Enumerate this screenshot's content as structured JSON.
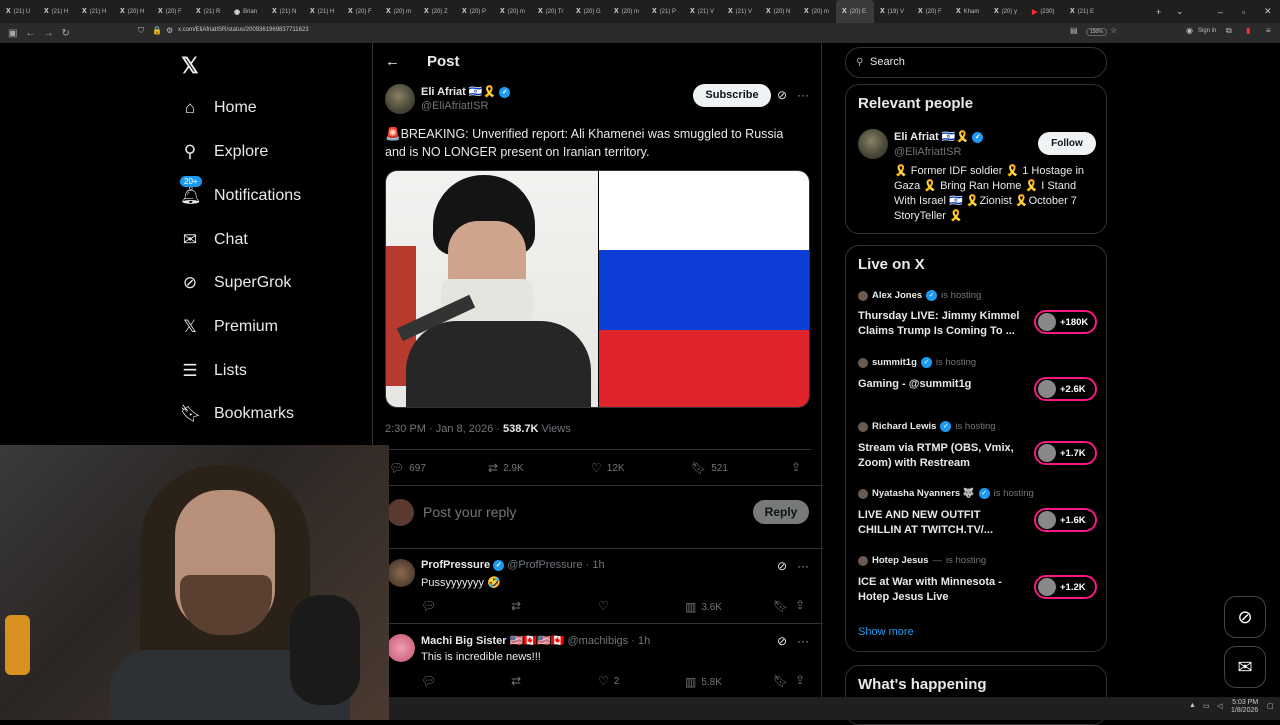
{
  "browser": {
    "tabs": [
      "(21) U",
      "(21) H",
      "(21) H",
      "(20) H",
      "(20) F",
      "(21) R",
      "Brian",
      "(21) N",
      "(21) H",
      "(20) F",
      "(20) m",
      "(20) Z",
      "(20) P",
      "(20) m",
      "(20) Tr",
      "(20) G",
      "(20) m",
      "(21) P",
      "(21) V",
      "(21) V",
      "(20) N",
      "(20) m",
      "(20) E",
      "(19) V",
      "(20) F",
      "Kham",
      "(20) y",
      "(230)",
      "(21) E"
    ],
    "url": "x.com/EliAfriatISR/status/2009361969837711623",
    "zoom": "150%",
    "sign_in": "Sign in"
  },
  "nav": {
    "logo": "𝕏",
    "notif_badge": "20+",
    "items": [
      {
        "label": "Home",
        "icon": "home-icon"
      },
      {
        "label": "Explore",
        "icon": "search-icon"
      },
      {
        "label": "Notifications",
        "icon": "bell-icon"
      },
      {
        "label": "Chat",
        "icon": "mail-icon"
      },
      {
        "label": "SuperGrok",
        "icon": "grok-icon"
      },
      {
        "label": "Premium",
        "icon": "x-icon"
      },
      {
        "label": "Lists",
        "icon": "list-icon"
      },
      {
        "label": "Bookmarks",
        "icon": "bookmark-icon"
      }
    ]
  },
  "post": {
    "header_title": "Post",
    "author_name": "Eli Afriat 🇮🇱🎗️",
    "author_handle": "@EliAfriatISR",
    "subscribe_label": "Subscribe",
    "text": "🚨BREAKING: Unverified report: Ali Khamenei was smuggled to Russia and is NO LONGER present on Iranian territory.",
    "time": "2:30 PM · Jan 8, 2026 · ",
    "views_count": "538.7K",
    "views_label": " Views",
    "replies": "697",
    "reposts": "2.9K",
    "likes": "12K",
    "bookmarks": "521",
    "reply_placeholder": "Post your reply",
    "reply_button": "Reply"
  },
  "comments": [
    {
      "name": "ProfPressure",
      "handle": "@ProfPressure · 1h",
      "text": "Pussyyyyyyy 🤣",
      "reply": "",
      "repost": "",
      "like": "",
      "views": "3.6K"
    },
    {
      "name": "Machi Big Sister 🇺🇸🇨🇦🇺🇸🇨🇦",
      "handle": "@machibigs · 1h",
      "text": "This is incredible news!!!",
      "reply": "",
      "repost": "",
      "like": "2",
      "views": "5.8K"
    }
  ],
  "sidebar": {
    "search_placeholder": "Search",
    "relevant_title": "Relevant people",
    "person_name": "Eli Afriat 🇮🇱🎗️",
    "person_handle": "@EliAfriatISR",
    "follow_label": "Follow",
    "person_bio": "🎗️ Former IDF soldier 🎗️ 1 Hostage in Gaza 🎗️ Bring Ran Home 🎗️ I Stand With Israel 🇮🇱 🎗️Zionist 🎗️October 7 StoryTeller 🎗️",
    "live_title": "Live on X",
    "hosting_label": "is hosting",
    "live": [
      {
        "host": "Alex Jones",
        "title": "Thursday LIVE: Jimmy Kimmel Claims Trump Is Coming To ...",
        "count": "+180K"
      },
      {
        "host": "summit1g",
        "title": "Gaming - @summit1g",
        "count": "+2.6K"
      },
      {
        "host": "Richard Lewis",
        "title": "Stream via RTMP (OBS, Vmix, Zoom) with Restream",
        "count": "+1.7K"
      },
      {
        "host": "Nyatasha Nyanners 🐺",
        "title": "LIVE AND NEW OUTFIT CHILLIN AT TWITCH.TV/...",
        "count": "+1.6K"
      },
      {
        "host": "Hotep Jesus",
        "title": "ICE at War with Minnesota - Hotep Jesus Live",
        "count": "+1.2K"
      }
    ],
    "show_more": "Show more",
    "happening_title": "What's happening"
  },
  "taskbar": {
    "time": "5:03 PM",
    "date": "1/8/2026"
  },
  "colors": {
    "accent": "#1d9bf0",
    "live": "#f91880",
    "bg": "#000000",
    "border": "#2f3336"
  }
}
